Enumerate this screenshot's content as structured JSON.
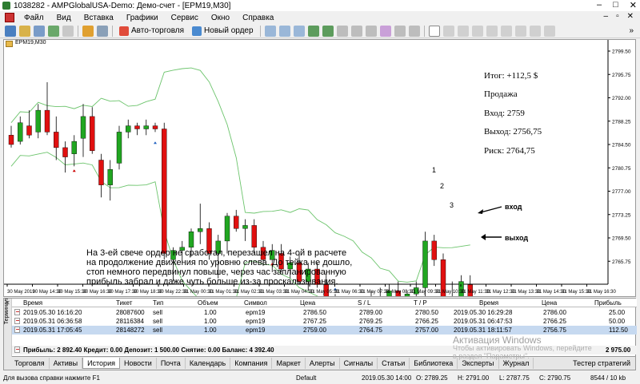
{
  "window": {
    "title": "1038282 - AMPGlobalUSA-Demo: Демо-счет - [EPM19,M30]",
    "controls": [
      "–",
      "□",
      "✕"
    ]
  },
  "menu": {
    "items": [
      "Файл",
      "Вид",
      "Вставка",
      "Графики",
      "Сервис",
      "Окно",
      "Справка"
    ],
    "mdi_controls": [
      "–",
      "▫",
      "✕"
    ]
  },
  "toolbar": {
    "autotrading_label": "Авто-торговля",
    "new_order_label": "Новый ордер"
  },
  "chart": {
    "header": "EPM19,M30",
    "bid_price_label": "2758.00",
    "y_ticks": [
      "2799.50",
      "2795.75",
      "2792.00",
      "2788.25",
      "2784.50",
      "2780.75",
      "2777.00",
      "2773.25",
      "2769.50",
      "2765.75",
      "2762.00",
      "2758.25",
      "2754.50",
      "2750.75",
      "2747.00",
      "2743.25"
    ],
    "x_ticks": [
      "30 May 2019",
      "30 May 14:30",
      "30 May 15:30",
      "30 May 16:30",
      "30 May 17:30",
      "30 May 18:30",
      "30 May 22:30",
      "31 May 00:30",
      "31 May 01:30",
      "31 May 02:30",
      "31 May 03:30",
      "31 May 04:30",
      "31 May 05:30",
      "31 May 06:30",
      "31 May 07:30",
      "31 May 08:30",
      "31 May 09:30",
      "31 May 10:30",
      "31 May 11:30",
      "31 May 12:30",
      "31 May 13:30",
      "31 May 14:30",
      "31 May 15:30",
      "31 May 16:30"
    ],
    "notes": {
      "total": "Итог: +112,5 $",
      "side": "Продажа",
      "entry": "Вход: 2759",
      "exit": "Выход: 2756,75",
      "risk": "Риск: 2764,75"
    },
    "markers": [
      "1",
      "2",
      "3"
    ],
    "arrow_entry": "вход",
    "arrow_exit": "выход",
    "comment": [
      "На 3-ей свече ордер не сработал, перезашел на 4-ой в расчете",
      "на продолжение движения по уровню слева. До тейка не дошло,",
      "стоп немного передвинул повыше, через час запланированную",
      "прибыль забрал и даже чуть больше из-за проскальзывания."
    ],
    "colors": {
      "bull": "#21a621",
      "bear": "#e01010",
      "band": "#6cc46c"
    }
  },
  "chart_data": {
    "type": "candlestick",
    "symbol": "EPM19",
    "timeframe": "M30",
    "ylim": [
      2743.25,
      2801.0
    ],
    "candles": [
      {
        "o": 2786.0,
        "h": 2787.5,
        "l": 2784.0,
        "c": 2784.5
      },
      {
        "o": 2785.0,
        "h": 2789.0,
        "l": 2784.5,
        "c": 2788.0
      },
      {
        "o": 2787.5,
        "h": 2790.0,
        "l": 2785.5,
        "c": 2786.0
      },
      {
        "o": 2786.5,
        "h": 2791.0,
        "l": 2785.5,
        "c": 2790.0
      },
      {
        "o": 2790.0,
        "h": 2794.5,
        "l": 2786.0,
        "c": 2786.5
      },
      {
        "o": 2786.5,
        "h": 2789.0,
        "l": 2782.0,
        "c": 2784.0
      },
      {
        "o": 2784.0,
        "h": 2785.0,
        "l": 2780.0,
        "c": 2782.5
      },
      {
        "o": 2783.0,
        "h": 2786.0,
        "l": 2781.0,
        "c": 2785.0
      },
      {
        "o": 2785.5,
        "h": 2791.0,
        "l": 2782.5,
        "c": 2789.0
      },
      {
        "o": 2789.0,
        "h": 2790.5,
        "l": 2783.0,
        "c": 2783.5
      },
      {
        "o": 2782.0,
        "h": 2783.0,
        "l": 2776.0,
        "c": 2778.0
      },
      {
        "o": 2778.0,
        "h": 2782.0,
        "l": 2775.5,
        "c": 2780.5
      },
      {
        "o": 2781.5,
        "h": 2787.5,
        "l": 2780.5,
        "c": 2786.5
      },
      {
        "o": 2786.5,
        "h": 2788.5,
        "l": 2785.5,
        "c": 2787.5
      },
      {
        "o": 2787.5,
        "h": 2788.0,
        "l": 2786.0,
        "c": 2787.0
      },
      {
        "o": 2787.0,
        "h": 2788.5,
        "l": 2786.0,
        "c": 2787.5
      },
      {
        "o": 2787.5,
        "h": 2788.0,
        "l": 2786.5,
        "c": 2787.0
      },
      {
        "o": 2787.0,
        "h": 2788.0,
        "l": 2766.0,
        "c": 2767.0
      },
      {
        "o": 2766.0,
        "h": 2768.0,
        "l": 2762.5,
        "c": 2767.5
      },
      {
        "o": 2767.5,
        "h": 2769.0,
        "l": 2765.5,
        "c": 2768.0
      },
      {
        "o": 2768.0,
        "h": 2771.0,
        "l": 2766.5,
        "c": 2770.5
      },
      {
        "o": 2770.5,
        "h": 2775.0,
        "l": 2768.5,
        "c": 2771.0
      },
      {
        "o": 2771.0,
        "h": 2772.0,
        "l": 2766.0,
        "c": 2767.0
      },
      {
        "o": 2767.0,
        "h": 2770.0,
        "l": 2763.0,
        "c": 2769.0
      },
      {
        "o": 2769.0,
        "h": 2773.5,
        "l": 2767.0,
        "c": 2773.0
      },
      {
        "o": 2773.0,
        "h": 2774.0,
        "l": 2770.5,
        "c": 2771.0
      },
      {
        "o": 2771.0,
        "h": 2772.5,
        "l": 2769.0,
        "c": 2771.5
      },
      {
        "o": 2771.5,
        "h": 2772.5,
        "l": 2767.0,
        "c": 2768.0
      },
      {
        "o": 2768.0,
        "h": 2769.0,
        "l": 2765.0,
        "c": 2766.0
      },
      {
        "o": 2766.0,
        "h": 2768.5,
        "l": 2764.0,
        "c": 2767.5
      },
      {
        "o": 2767.0,
        "h": 2768.5,
        "l": 2764.0,
        "c": 2764.5
      },
      {
        "o": 2764.5,
        "h": 2766.5,
        "l": 2763.0,
        "c": 2765.5
      },
      {
        "o": 2765.5,
        "h": 2767.0,
        "l": 2762.0,
        "c": 2762.5
      },
      {
        "o": 2762.5,
        "h": 2765.5,
        "l": 2761.0,
        "c": 2764.5
      },
      {
        "o": 2764.5,
        "h": 2765.5,
        "l": 2761.5,
        "c": 2762.0
      },
      {
        "o": 2762.0,
        "h": 2764.0,
        "l": 2759.0,
        "c": 2759.5
      },
      {
        "o": 2759.5,
        "h": 2760.5,
        "l": 2756.0,
        "c": 2757.0
      },
      {
        "o": 2757.0,
        "h": 2758.0,
        "l": 2755.0,
        "c": 2756.5
      },
      {
        "o": 2756.5,
        "h": 2759.5,
        "l": 2755.0,
        "c": 2758.0
      },
      {
        "o": 2758.0,
        "h": 2760.0,
        "l": 2756.5,
        "c": 2759.5
      },
      {
        "o": 2759.5,
        "h": 2761.0,
        "l": 2757.5,
        "c": 2760.0
      },
      {
        "o": 2760.0,
        "h": 2761.5,
        "l": 2758.5,
        "c": 2759.0
      },
      {
        "o": 2759.0,
        "h": 2762.0,
        "l": 2758.0,
        "c": 2761.0
      },
      {
        "o": 2761.0,
        "h": 2762.5,
        "l": 2757.5,
        "c": 2758.0
      },
      {
        "o": 2758.0,
        "h": 2761.0,
        "l": 2755.0,
        "c": 2760.5
      },
      {
        "o": 2760.5,
        "h": 2762.5,
        "l": 2757.5,
        "c": 2761.5
      },
      {
        "o": 2761.5,
        "h": 2770.5,
        "l": 2758.5,
        "c": 2769.0
      },
      {
        "o": 2769.0,
        "h": 2770.0,
        "l": 2765.0,
        "c": 2766.0
      },
      {
        "o": 2766.0,
        "h": 2767.0,
        "l": 2759.5,
        "c": 2760.0
      },
      {
        "o": 2760.0,
        "h": 2762.5,
        "l": 2758.5,
        "c": 2759.0
      },
      {
        "o": 2759.0,
        "h": 2763.5,
        "l": 2757.5,
        "c": 2762.5
      },
      {
        "o": 2762.0,
        "h": 2763.5,
        "l": 2756.0,
        "c": 2757.0
      }
    ]
  },
  "terminal": {
    "side_label": "Терминал",
    "columns": [
      "Время",
      "Тикет",
      "Тип",
      "Объем",
      "Символ",
      "Цена",
      "S / L",
      "T / P",
      "Время",
      "Цена",
      "Прибыль"
    ],
    "rows": [
      {
        "open_time": "2019.05.30 16:16:20",
        "ticket": "28087600",
        "type": "sell",
        "volume": "1.00",
        "symbol": "epm19",
        "price": "2786.50",
        "sl": "2789.00",
        "tp": "2780.50",
        "close_time": "2019.05.30 16:29:28",
        "close_price": "2786.00",
        "profit": "25.00"
      },
      {
        "open_time": "2019.05.31 06:36:58",
        "ticket": "28116384",
        "type": "sell",
        "volume": "1.00",
        "symbol": "epm19",
        "price": "2767.25",
        "sl": "2769.25",
        "tp": "2766.25",
        "close_time": "2019.05.31 06:47:53",
        "close_price": "2766.25",
        "profit": "50.00"
      },
      {
        "open_time": "2019.05.31 17:05:45",
        "ticket": "28148272",
        "type": "sell",
        "volume": "1.00",
        "symbol": "epm19",
        "price": "2759.00",
        "sl": "2764.75",
        "tp": "2757.00",
        "close_time": "2019.05.31 18:11:57",
        "close_price": "2756.75",
        "profit": "112.50"
      }
    ],
    "summary": "Прибыль: 2 892.40  Кредит: 0.00  Депозит: 1 500.00  Снятие: 0.00  Баланс: 4 392.40",
    "summary_total": "2 975.00"
  },
  "tabs": {
    "items": [
      "Торговля",
      "Активы",
      "История",
      "Новости",
      "Почта",
      "Календарь",
      "Компания",
      "Маркет",
      "Алерты",
      "Сигналы",
      "Статьи",
      "Библиотека",
      "Эксперты",
      "Журнал"
    ],
    "active": "История",
    "strategy_tester": "Тестер стратегий"
  },
  "watermark": {
    "line1": "Активация Windows",
    "line2": "Чтобы активировать Windows, перейдите",
    "line3": "в раздел \"Параметры\"."
  },
  "status": {
    "help": "Для вызова справки нажмите F1",
    "profile": "Default",
    "datetime": "2019.05.30 14:00",
    "open": "O: 2789.25",
    "high": "H: 2791.00",
    "low": "L: 2787.75",
    "close": "C: 2790.75",
    "traffic": "8544 / 10 kb"
  }
}
